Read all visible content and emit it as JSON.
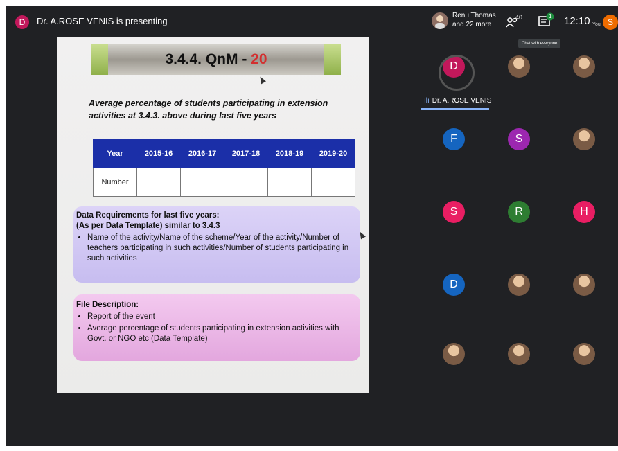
{
  "header": {
    "presenter_initial": "D",
    "presenter_text": "Dr. A.ROSE VENIS is presenting",
    "people_line1": "Renu Thomas",
    "people_line2": "and 22 more",
    "participant_count": "40",
    "chat_badge": "1",
    "clock": "12:10",
    "you_label": "You",
    "you_initial": "S",
    "tooltip": "Chat with everyone"
  },
  "slide": {
    "title_prefix": "3.4.4. QnM - ",
    "title_number": "20",
    "subtitle": "Average percentage of students participating in extension activities at 3.4.3. above during last five years",
    "table": {
      "headers": [
        "Year",
        "2015-16",
        "2016-17",
        "2017-18",
        "2018-19",
        "2019-20"
      ],
      "row_label": "Number"
    },
    "requirements": {
      "heading1": "Data Requirements for last five years:",
      "heading2": "(As per Data Template) similar to 3.4.3",
      "bullet": "Name of the activity/Name of the scheme/Year of the activity/Number of teachers participating in such activities/Number of students participating in such activities"
    },
    "file_description": {
      "heading": "File Description:",
      "bullets": [
        "Report of the event",
        "Average percentage of students participating in extension activities with Govt. or NGO etc (Data Template)"
      ]
    }
  },
  "participants": {
    "speaker_name": "Dr. A.ROSE VENIS",
    "tiles": [
      {
        "initial": "D",
        "color": "#c2185b"
      },
      {
        "initial": "",
        "color": "#8d6e63"
      },
      {
        "initial": "",
        "color": "#4a3b5c"
      },
      {
        "initial": "F",
        "color": "#1565c0"
      },
      {
        "initial": "S",
        "color": "#9c27b0"
      },
      {
        "initial": "",
        "color": "#d84315"
      },
      {
        "initial": "S",
        "color": "#e91e63"
      },
      {
        "initial": "R",
        "color": "#2e7d32"
      },
      {
        "initial": "H",
        "color": "#e91e63"
      },
      {
        "initial": "D",
        "color": "#1565c0"
      },
      {
        "initial": "",
        "color": "#5d4037"
      },
      {
        "initial": "",
        "color": "#6d4c41"
      },
      {
        "initial": "",
        "color": "#8d6e63"
      },
      {
        "initial": "",
        "color": "#5d4037"
      },
      {
        "initial": "",
        "color": "#5d4037"
      }
    ]
  }
}
